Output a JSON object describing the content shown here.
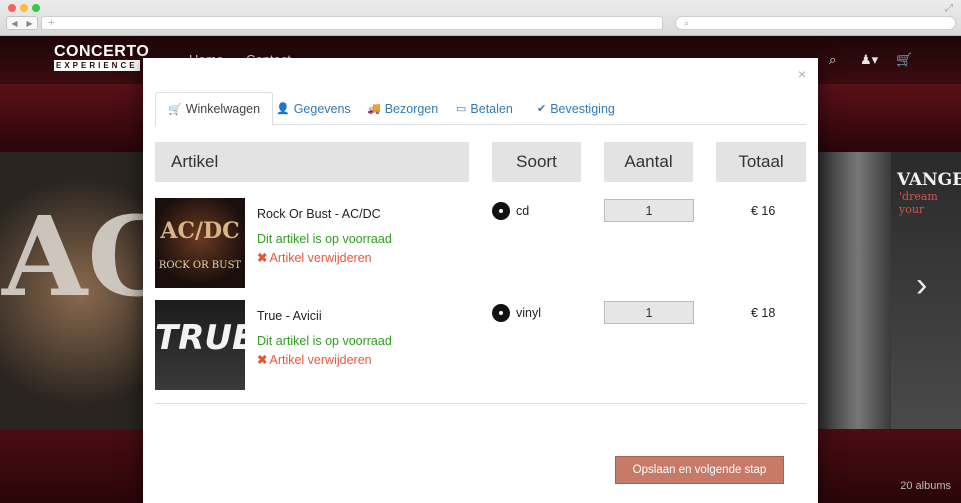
{
  "browser": {
    "url_placeholder": "+",
    "search_placeholder": "⌕"
  },
  "site": {
    "logo_main": "CONCERTO",
    "logo_sub": "EXPERIENCE",
    "nav": [
      "Home",
      "Contact"
    ],
    "albums_count": "20 albums",
    "covers": {
      "left_letters": "AG",
      "right_title": "VANGE",
      "right_subtitle": "'dream your"
    }
  },
  "modal": {
    "close_label": "×",
    "tabs": [
      {
        "label": "Winkelwagen",
        "icon": "cart-icon",
        "active": true
      },
      {
        "label": "Gegevens",
        "icon": "user-icon",
        "active": false
      },
      {
        "label": "Bezorgen",
        "icon": "truck-icon",
        "active": false
      },
      {
        "label": "Betalen",
        "icon": "credit-card-icon",
        "active": false
      },
      {
        "label": "Bevestiging",
        "icon": "check-circle-icon",
        "active": false
      }
    ],
    "columns": {
      "artikel": "Artikel",
      "soort": "Soort",
      "aantal": "Aantal",
      "totaal": "Totaal"
    },
    "items": [
      {
        "name": "Rock Or Bust - AC/DC",
        "stock": "Dit artikel is op voorraad",
        "remove": "Artikel verwijderen",
        "type": "cd",
        "quantity": "1",
        "price": "€ 16",
        "cover_text": "AC/DC",
        "cover_sub": "ROCK OR BUST"
      },
      {
        "name": "True - Avicii",
        "stock": "Dit artikel is op voorraad",
        "remove": "Artikel verwijderen",
        "type": "vinyl",
        "quantity": "1",
        "price": "€ 18",
        "cover_text": "TRUE"
      }
    ],
    "next_button": "Opslaan en volgende stap"
  },
  "colors": {
    "link": "#337ab7",
    "in_stock": "#2e9f1f",
    "remove": "#e8573c",
    "primary_button": "#c87a68"
  }
}
